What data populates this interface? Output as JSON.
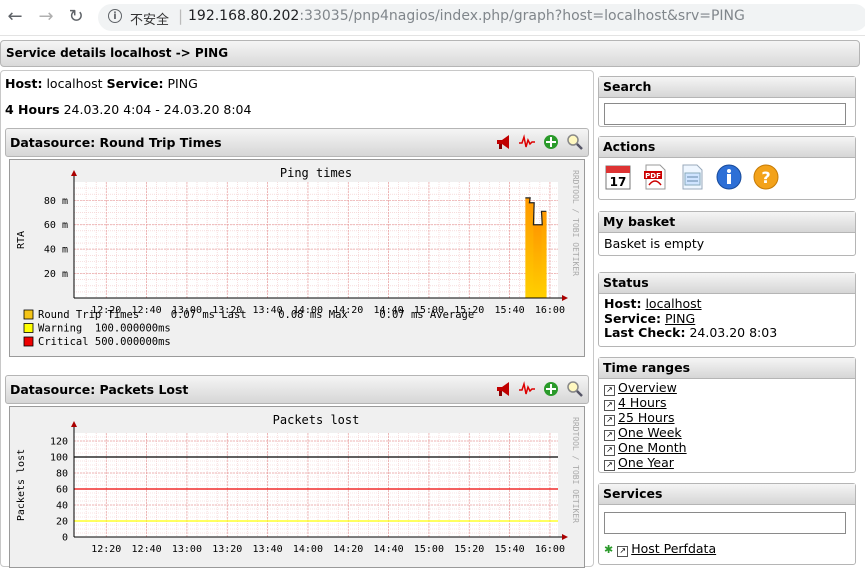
{
  "browser": {
    "security_label": "不安全",
    "url_host": "192.168.80.202",
    "url_rest": ":33035/pnp4nagios/index.php/graph?host=localhost&srv=PING"
  },
  "page": {
    "header": "Service details localhost -> PING",
    "host_label": "Host:",
    "host_value": "localhost",
    "service_label": "Service:",
    "service_value": "PING",
    "period_label": "4 Hours",
    "period_range": "24.03.20 4:04 - 24.03.20 8:04"
  },
  "datasources": [
    {
      "title": "Datasource: Round Trip Times",
      "graph_title": "Ping times",
      "ylabel": "RTA",
      "watermark": "RRDTOOL / TOBI OETIKER",
      "legend": [
        {
          "label": "Round Trip Times     0.07 ms Last     0.08 ms Max     0.07 ms Average",
          "color": "#f5c518"
        },
        {
          "label": "Warning  100.000000ms",
          "color": "#ffff00"
        },
        {
          "label": "Critical 500.000000ms",
          "color": "#ee0000"
        }
      ]
    },
    {
      "title": "Datasource: Packets Lost",
      "graph_title": "Packets lost",
      "ylabel": "Packets lost",
      "watermark": "RRDTOOL / TOBI OETIKER"
    }
  ],
  "chart_data": [
    {
      "type": "area",
      "title": "Ping times",
      "ylabel": "RTA",
      "xlabel": "",
      "x_ticks": [
        "12:20",
        "12:40",
        "13:00",
        "13:20",
        "13:40",
        "14:00",
        "14:20",
        "14:40",
        "15:00",
        "15:20",
        "15:40",
        "16:00"
      ],
      "y_ticks": [
        "20 m",
        "40 m",
        "60 m",
        "80 m"
      ],
      "ylim": [
        0,
        95
      ],
      "series": [
        {
          "name": "Round Trip Times",
          "x": [
            "15:49",
            "15:51",
            "15:53",
            "15:55",
            "15:57"
          ],
          "values": [
            82,
            78,
            60,
            60,
            71
          ]
        }
      ],
      "grid": true
    },
    {
      "type": "line",
      "title": "Packets lost",
      "ylabel": "Packets lost",
      "xlabel": "",
      "x_ticks": [
        "12:20",
        "12:40",
        "13:00",
        "13:20",
        "13:40",
        "14:00",
        "14:20",
        "14:40",
        "15:00",
        "15:20",
        "15:40",
        "16:00"
      ],
      "y_ticks": [
        "0",
        "20",
        "40",
        "60",
        "80",
        "100",
        "120"
      ],
      "ylim": [
        0,
        130
      ],
      "series": [
        {
          "name": "",
          "values": [
            100
          ],
          "color": "#000000"
        },
        {
          "name": "",
          "values": [
            60
          ],
          "color": "#ee0000"
        },
        {
          "name": "",
          "values": [
            20
          ],
          "color": "#ffff00"
        }
      ],
      "grid": true
    }
  ],
  "sidebar": {
    "search_title": "Search",
    "actions_title": "Actions",
    "actions_icons": [
      "calendar-icon",
      "pdf-icon",
      "xml-icon",
      "info-icon",
      "help-icon"
    ],
    "basket_title": "My basket",
    "basket_text": "Basket is empty",
    "status_title": "Status",
    "status_host_label": "Host:",
    "status_host_value": "localhost",
    "status_service_label": "Service:",
    "status_service_value": "PING",
    "status_check_label": "Last Check:",
    "status_check_value": "24.03.20 8:03",
    "timeranges_title": "Time ranges",
    "timeranges": [
      "Overview",
      "4 Hours",
      "25 Hours",
      "One Week",
      "One Month",
      "One Year"
    ],
    "services_title": "Services",
    "services_item": "Host Perfdata"
  }
}
